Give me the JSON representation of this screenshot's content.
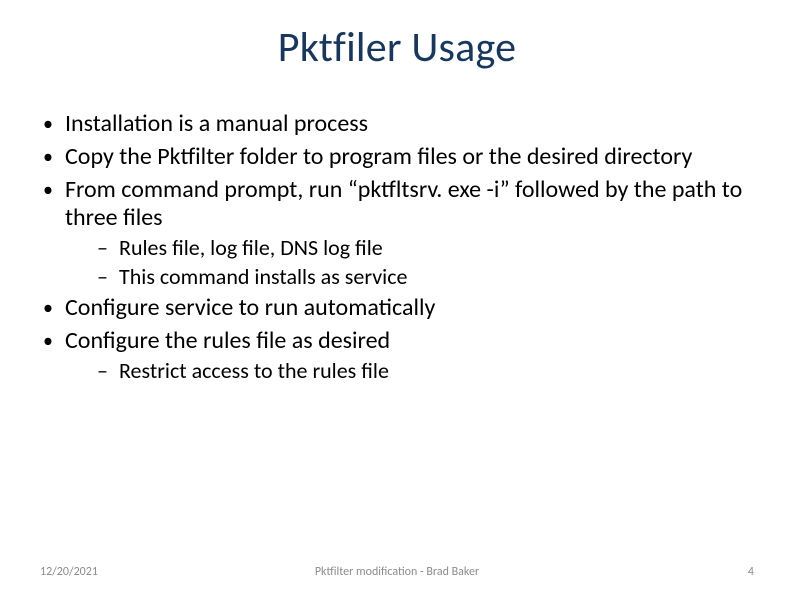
{
  "title": "Pktfiler Usage",
  "bullets": [
    {
      "text": "Installation is a manual process"
    },
    {
      "text": "Copy the Pktfilter folder to program files or the desired directory"
    },
    {
      "text": "From command prompt, run “pktfltsrv. exe -i” followed by the path to three files",
      "sub": [
        "Rules file, log file, DNS log file",
        "This command installs as service"
      ]
    },
    {
      "text": "Configure service to run automatically"
    },
    {
      "text": "Configure the rules file as desired",
      "sub": [
        "Restrict access to the rules file"
      ]
    }
  ],
  "footer": {
    "date": "12/20/2021",
    "center": "Pktfilter modification - Brad Baker",
    "page": "4"
  }
}
